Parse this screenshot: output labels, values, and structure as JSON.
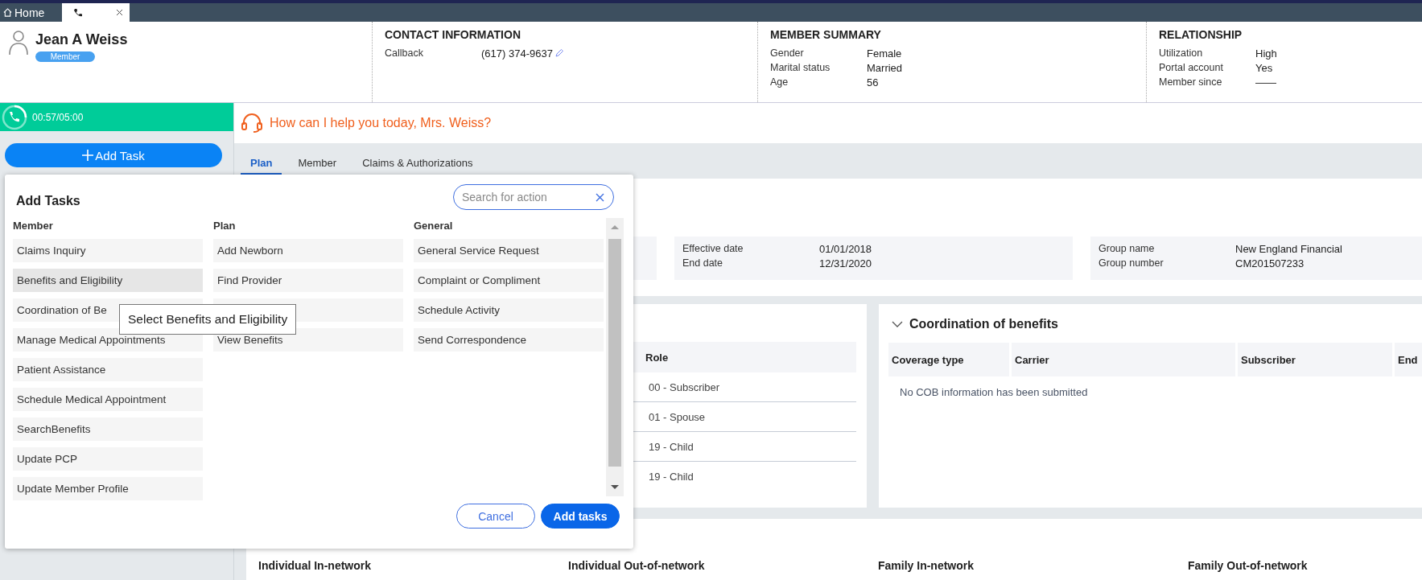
{
  "tabs": [
    {
      "kind": "home",
      "label": "Home",
      "selected": false
    },
    {
      "kind": "phone",
      "selected": true,
      "closable": true
    }
  ],
  "member": {
    "name": "Jean A Weiss",
    "badge": "Member"
  },
  "contact": {
    "title": "CONTACT INFORMATION",
    "fields": [
      {
        "label": "Callback",
        "value": "(617) 374-9637",
        "editable": true
      }
    ]
  },
  "summary": {
    "title": "MEMBER SUMMARY",
    "fields": [
      {
        "label": "Gender",
        "value": "Female"
      },
      {
        "label": "Marital status",
        "value": "Married"
      },
      {
        "label": "Age",
        "value": "56"
      }
    ]
  },
  "relationship": {
    "title": "RELATIONSHIP",
    "fields": [
      {
        "label": "Utilization",
        "value": "High"
      },
      {
        "label": "Portal account",
        "value": "Yes"
      },
      {
        "label": "Member since",
        "value": "——"
      }
    ]
  },
  "call": {
    "timer": "00:57/05:00"
  },
  "greeting": "How can I help you today, Mrs. Weiss?",
  "add_task_button": "Add Task",
  "plan_tabs": [
    {
      "label": "Plan",
      "selected": true
    },
    {
      "label": "Member",
      "selected": false
    },
    {
      "label": "Claims & Authorizations",
      "selected": false
    }
  ],
  "plan_info": [
    {
      "fields": [
        {
          "label": "Effective date",
          "value": "01/01/2018"
        },
        {
          "label": "End date",
          "value": "12/31/2020"
        }
      ]
    },
    {
      "fields": [
        {
          "label": "Group name",
          "value": "New England Financial"
        },
        {
          "label": "Group number",
          "value": "CM201507233"
        }
      ]
    }
  ],
  "members_table": {
    "columns": [
      "Role"
    ],
    "rows": [
      "00 - Subscriber",
      "01 - Spouse",
      "19 - Child",
      "19 - Child"
    ]
  },
  "cob": {
    "title": "Coordination of benefits",
    "expanded": true,
    "columns": [
      "Coverage type",
      "Carrier",
      "Subscriber",
      "End"
    ],
    "empty_message": "No COB information has been submitted"
  },
  "accumulators": [
    "Individual In-network",
    "Individual Out-of-network",
    "Family In-network",
    "Family Out-of-network"
  ],
  "dialog": {
    "title": "Add Tasks",
    "search_placeholder": "Search for action",
    "columns": [
      {
        "heading": "Member",
        "items": [
          {
            "label": "Claims Inquiry",
            "selected": false
          },
          {
            "label": "Benefits and Eligibility",
            "selected": true
          },
          {
            "label": "Coordination of Be",
            "selected": false
          },
          {
            "label": "Manage Medical Appointments",
            "selected": false
          },
          {
            "label": "Patient Assistance",
            "selected": false
          },
          {
            "label": "Schedule Medical Appointment",
            "selected": false
          },
          {
            "label": "SearchBenefits",
            "selected": false
          },
          {
            "label": "Update PCP",
            "selected": false
          },
          {
            "label": "Update Member Profile",
            "selected": false
          }
        ]
      },
      {
        "heading": "Plan",
        "items": [
          {
            "label": "Add Newborn",
            "selected": false
          },
          {
            "label": "Find Provider",
            "selected": false
          },
          {
            "selected": false
          },
          {
            "label": "View Benefits",
            "selected": false
          }
        ]
      },
      {
        "heading": "General",
        "items": [
          {
            "label": "General Service Request",
            "selected": false
          },
          {
            "label": "Complaint or Compliment",
            "selected": false
          },
          {
            "label": "Schedule Activity",
            "selected": false
          },
          {
            "label": "Send Correspondence",
            "selected": false
          }
        ]
      }
    ],
    "tooltip": "Select Benefits and Eligibility",
    "buttons": [
      {
        "label": "Cancel",
        "kind": "secondary"
      },
      {
        "label": "Add tasks",
        "kind": "primary"
      }
    ]
  }
}
